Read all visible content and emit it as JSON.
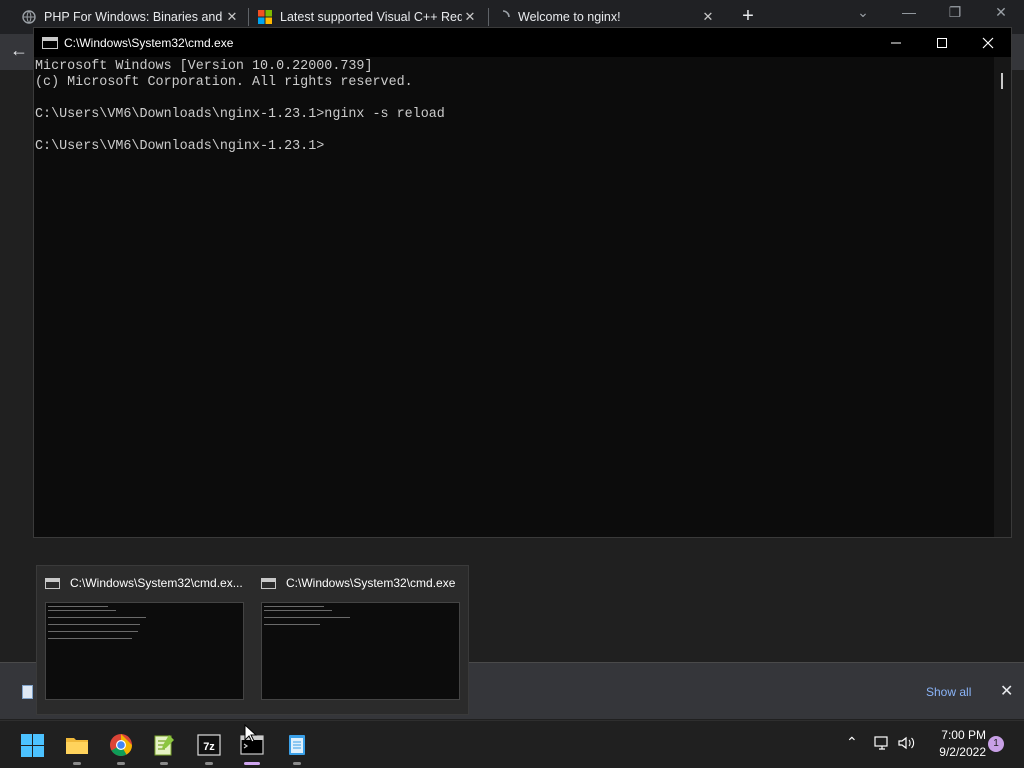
{
  "browser": {
    "tabs": [
      {
        "title": "PHP For Windows: Binaries and so",
        "icon": "globe-icon"
      },
      {
        "title": "Latest supported Visual C++ Redi",
        "icon": "microsoft-icon"
      },
      {
        "title": "Welcome to nginx!",
        "icon": "loading-icon"
      }
    ],
    "new_tab": "+",
    "close_glyph": "✕"
  },
  "cmd": {
    "title": "C:\\Windows\\System32\\cmd.exe",
    "lines": [
      "Microsoft Windows [Version 10.0.22000.739]",
      "(c) Microsoft Corporation. All rights reserved.",
      "",
      "C:\\Users\\VM6\\Downloads\\nginx-1.23.1>nginx -s reload",
      "",
      "C:\\Users\\VM6\\Downloads\\nginx-1.23.1>"
    ]
  },
  "thumbnails": [
    {
      "title": "C:\\Windows\\System32\\cmd.ex..."
    },
    {
      "title": "C:\\Windows\\System32\\cmd.exe"
    }
  ],
  "download_bar": {
    "show_all": "Show all"
  },
  "taskbar": {
    "time": "7:00 PM",
    "date": "9/2/2022",
    "notification_count": "1",
    "apps": [
      "start-icon",
      "file-explorer-icon",
      "chrome-icon",
      "notepad-plus-plus-icon",
      "7zip-icon",
      "cmd-icon",
      "notepad-icon"
    ]
  }
}
